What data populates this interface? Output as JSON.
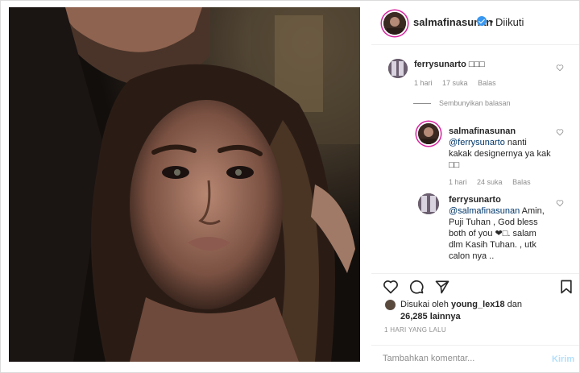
{
  "post": {
    "username": "salmafinasunan",
    "dot": "•",
    "follow_status": "Diikuti"
  },
  "comments": [
    {
      "username": "ferrysunarto",
      "text": "□□□",
      "time": "1 hari",
      "likes": "17 suka",
      "reply": "Balas"
    }
  ],
  "hide_replies_label": "Sembunyikan balasan",
  "replies": [
    {
      "username": "salmafinasunan",
      "mention": "@ferrysunarto",
      "text_line1": " nanti",
      "text_line2": "kakak designernya ya kak",
      "text_line3": "□□",
      "time": "1 hari",
      "likes": "24 suka",
      "reply": "Balas"
    },
    {
      "username": "ferrysunarto",
      "mention": "@salmafinasunan",
      "text_line1": " Amin,",
      "text_line2": "Puji Tuhan , God bless",
      "text_line3": "both of you ❤□. salam",
      "text_line4": "dlm Kasih Tuhan. , utk",
      "text_line5": "calon nya .."
    }
  ],
  "likes_section": {
    "prefix": "Disukai oleh ",
    "user": "young_lex18",
    "suffix": " dan",
    "count": "26,285 lainnya"
  },
  "timestamp": "1 HARI YANG LALU",
  "comment_box": {
    "placeholder": "Tambahkan komentar...",
    "post_label": "Kirim"
  },
  "colors": {
    "accent": "#3897f0",
    "muted": "#8e8e8e",
    "post_disabled": "#b2dffc"
  }
}
